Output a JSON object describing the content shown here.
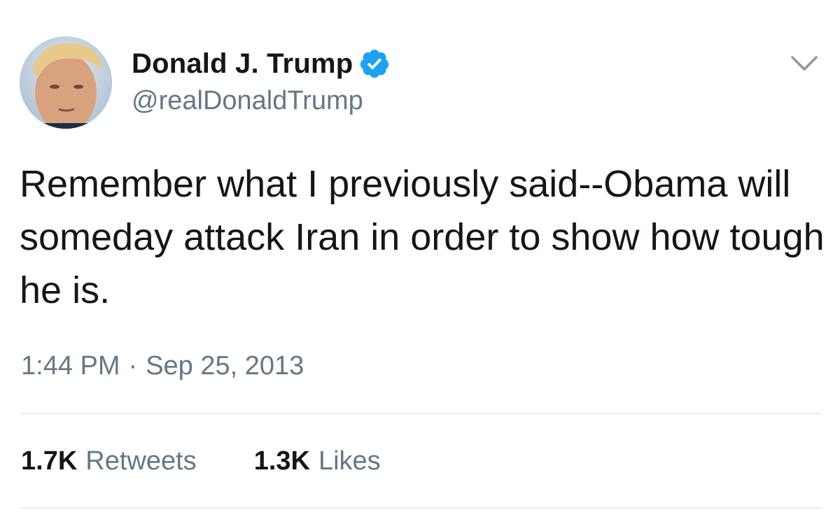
{
  "user": {
    "display_name": "Donald J. Trump",
    "handle": "@realDonaldTrump",
    "verified": true,
    "verified_color": "#1da1f2"
  },
  "tweet": {
    "text": "Remember what I previously said--Obama will someday attack Iran in order to show how tough he is.",
    "time": "1:44 PM",
    "separator": "·",
    "date": "Sep 25, 2013"
  },
  "stats": {
    "retweets_count": "1.7K",
    "retweets_label": "Retweets",
    "likes_count": "1.3K",
    "likes_label": "Likes"
  },
  "icons": [
    "verified-badge-icon",
    "chevron-down-icon"
  ],
  "colors": {
    "text_primary": "#14171a",
    "text_secondary": "#657786",
    "divider": "#e6ecf0"
  }
}
